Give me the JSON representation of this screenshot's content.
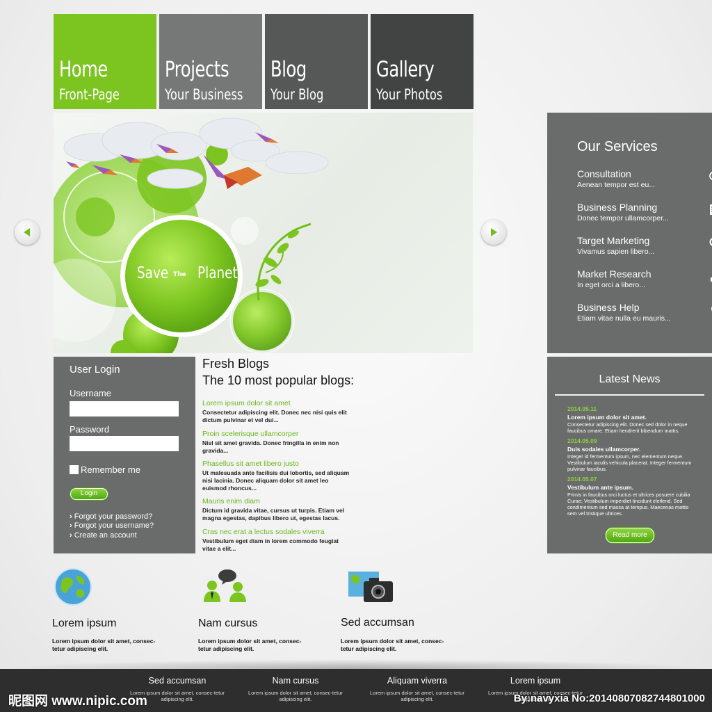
{
  "nav": [
    {
      "title": "Home",
      "subtitle": "Front-Page",
      "color": "#7cc520"
    },
    {
      "title": "Projects",
      "subtitle": "Your Business",
      "color": "#767777"
    },
    {
      "title": "Blog",
      "subtitle": "Your Blog",
      "color": "#565757"
    },
    {
      "title": "Gallery",
      "subtitle": "Your Photos",
      "color": "#424343"
    }
  ],
  "hero": {
    "text_left": "Save",
    "text_mid": "The",
    "text_right": "Planet"
  },
  "services": {
    "title": "Our Services",
    "items": [
      {
        "name": "Consultation",
        "desc": "Aenean tempor est eu...",
        "icon": "speech-bubble-icon"
      },
      {
        "name": "Business Planning",
        "desc": "Donec tempor ullamcorper...",
        "icon": "document-pen-icon"
      },
      {
        "name": "Target Marketing",
        "desc": "Vivamus sapien libero...",
        "icon": "magnifier-icon"
      },
      {
        "name": "Market Research",
        "desc": "In eget orci a libero...",
        "icon": "bar-chart-icon"
      },
      {
        "name": "Business Help",
        "desc": "Etiam vitae nulla eu mauris...",
        "icon": "lightbulb-icon"
      }
    ]
  },
  "login": {
    "title": "User Login",
    "username_label": "Username",
    "password_label": "Password",
    "remember_label": "Remember me",
    "button": "Login",
    "links": [
      "Forgot your password?",
      "Forgot your username?",
      "Create an account"
    ]
  },
  "blogs": {
    "title": "Fresh Blogs",
    "subtitle": "The 10 most popular blogs:",
    "items": [
      {
        "title": "Lorem ipsum dolor sit amet",
        "text": "Consectetur adipiscing elit. Donec nec nisi quis elit dictum pulvinar et vel dui..."
      },
      {
        "title": "Proin scelerisque ullamcorper",
        "text": "Nisl sit amet gravida. Donec fringilla in enim non gravida..."
      },
      {
        "title": "Phasellus sit amet libero justo",
        "text": "Ut malesuada ante facilisis dui lobortis, sed aliquam nisi lacinia. Donec aliquam dolor sit amet leo euismod rhoncus..."
      },
      {
        "title": "Mauris enim diam",
        "text": "Dictum id gravida vitae, cursus ut turpis. Etiam vel magna egestas, dapibus libero ut, egestas lacus."
      },
      {
        "title": "Cras nec erat a lectus sodales viverra",
        "text": "Vestibulum eget diam in lorem commodo feugiat vitae a elit..."
      }
    ]
  },
  "news": {
    "title": "Latest News",
    "items": [
      {
        "date": "2014.05.11",
        "headline": "Lorem ipsum dolor sit amet.",
        "text": "Consectetur adipiscing elit. Donec sed dolor in neque faucibus omare. Etiam hendrerit bibendum mattis."
      },
      {
        "date": "2014.05.09",
        "headline": "Duis sodales ullamcorper.",
        "text": "Integer id fermentum ipsum, nec elementum neque. Vestibulum iaculis vehicula placerat. Integer fermentum pulvinar faucibus."
      },
      {
        "date": "2014.05.07",
        "headline": "Vestibulum ante ipsum.",
        "text": "Primis in faucibus orci luctus et ultrices posuere cubilia Curae; Vestibulum imperdiet tincidunt eleifend. Sed condimentum sed massa at tempus. Maecenas mattis sem vel tristique ultrices."
      }
    ],
    "button": "Read more"
  },
  "features": [
    {
      "title": "Lorem ipsum",
      "desc": "Lorem ipsum dolor sit amet, consec-tetur adipiscing elit.",
      "icon": "globe-icon"
    },
    {
      "title": "Nam cursus",
      "desc": "Lorem ipsum dolor sit amet, consec-tetur adipiscing elit.",
      "icon": "people-chat-icon"
    },
    {
      "title": "Sed accumsan",
      "desc": "Lorem ipsum dolor sit amet, consec-tetur adipiscing elit.",
      "icon": "camera-map-icon"
    }
  ],
  "footer": [
    {
      "title": "Sed accumsan",
      "desc": "Lorem ipsum dolor sit amet, consec-tetur adipiscing elit."
    },
    {
      "title": "Nam cursus",
      "desc": "Lorem ipsum dolor sit amet, consec-tetur adipiscing elit."
    },
    {
      "title": "Aliquam viverra",
      "desc": "Lorem ipsum dolor sit amet, consec-tetur adipiscing elit."
    },
    {
      "title": "Lorem ipsum",
      "desc": "Lorem ipsum dolor sit amet, consec-tetur adipiscing elit."
    }
  ],
  "watermark": {
    "left": "昵图网 www.nipic.com",
    "right": "By:navyxia No:20140807082744801000"
  },
  "colors": {
    "accent": "#7cc520",
    "panel": "#6a6b6b",
    "footer": "#2e2e2e"
  }
}
